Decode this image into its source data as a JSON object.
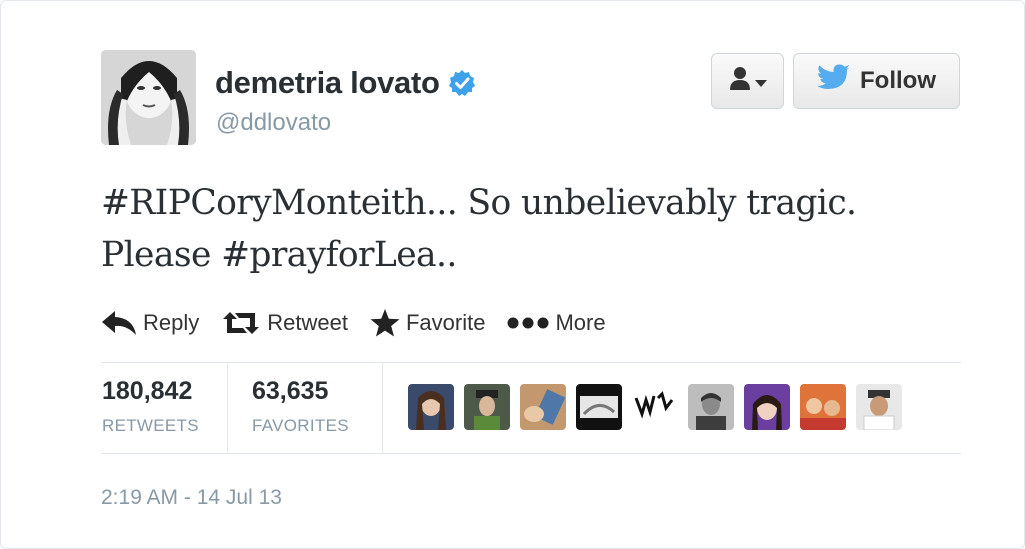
{
  "user": {
    "display_name": "demetria lovato",
    "handle": "@ddlovato",
    "verified_icon": "verified-badge-icon"
  },
  "buttons": {
    "user_menu_icon": "person-dropdown-icon",
    "follow_label": "Follow",
    "follow_icon": "twitter-bird-icon"
  },
  "tweet": {
    "line1": "#RIPCoryMonteith... So unbelievably tragic.",
    "line2": "Please #prayforLea.."
  },
  "actions": [
    {
      "label": "Reply",
      "icon": "reply-arrow-icon"
    },
    {
      "label": "Retweet",
      "icon": "retweet-icon"
    },
    {
      "label": "Favorite",
      "icon": "star-icon"
    },
    {
      "label": "More",
      "icon": "ellipsis-icon"
    }
  ],
  "stats": {
    "retweets_value": "180,842",
    "retweets_label": "RETWEETS",
    "favorites_value": "63,635",
    "favorites_label": "FAVORITES"
  },
  "timestamp": "2:19 AM - 14 Jul 13",
  "colors": {
    "verified": "#3ea1ec",
    "twitter_blue": "#55acee",
    "muted_text": "#8899a6"
  }
}
